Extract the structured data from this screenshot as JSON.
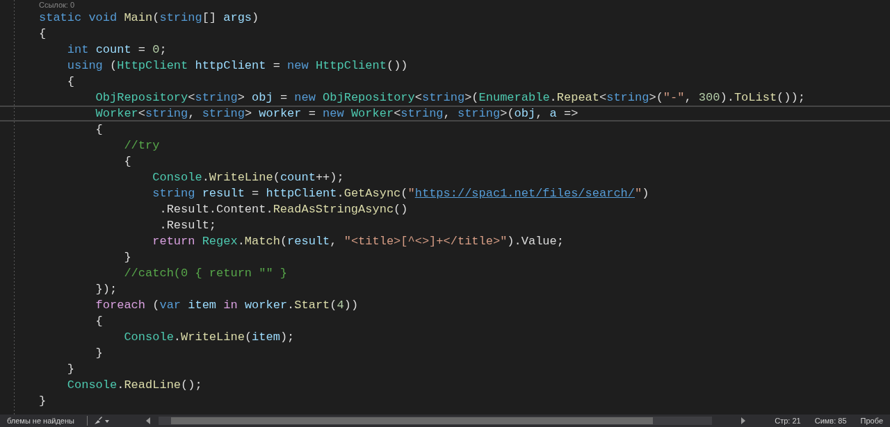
{
  "codelens": "Ссылок: 0",
  "code_lines": [
    {
      "current": false,
      "tokens": [
        {
          "text": "static void ",
          "kind": "kw"
        },
        {
          "text": "Main",
          "kind": "fn"
        },
        {
          "text": "(",
          "kind": "pl"
        },
        {
          "text": "string",
          "kind": "kw"
        },
        {
          "text": "[] ",
          "kind": "pl"
        },
        {
          "text": "args",
          "kind": "id"
        },
        {
          "text": ")",
          "kind": "pl"
        }
      ]
    },
    {
      "current": false,
      "tokens": [
        {
          "text": "{",
          "kind": "pl"
        }
      ]
    },
    {
      "current": false,
      "tokens": [
        {
          "text": "    int ",
          "kind": "kw"
        },
        {
          "text": "count",
          "kind": "id"
        },
        {
          "text": " = ",
          "kind": "pl"
        },
        {
          "text": "0",
          "kind": "num"
        },
        {
          "text": ";",
          "kind": "pl"
        }
      ]
    },
    {
      "current": false,
      "tokens": [
        {
          "text": "    using ",
          "kind": "kw"
        },
        {
          "text": "(",
          "kind": "pl"
        },
        {
          "text": "HttpClient ",
          "kind": "type"
        },
        {
          "text": "httpClient",
          "kind": "id"
        },
        {
          "text": " = ",
          "kind": "pl"
        },
        {
          "text": "new ",
          "kind": "kw"
        },
        {
          "text": "HttpClient",
          "kind": "type"
        },
        {
          "text": "())",
          "kind": "pl"
        }
      ]
    },
    {
      "current": false,
      "tokens": [
        {
          "text": "    {",
          "kind": "pl"
        }
      ]
    },
    {
      "current": false,
      "tokens": [
        {
          "text": "        ObjRepository",
          "kind": "type"
        },
        {
          "text": "<",
          "kind": "pl"
        },
        {
          "text": "string",
          "kind": "kw"
        },
        {
          "text": "> ",
          "kind": "pl"
        },
        {
          "text": "obj",
          "kind": "id"
        },
        {
          "text": " = ",
          "kind": "pl"
        },
        {
          "text": "new ",
          "kind": "kw"
        },
        {
          "text": "ObjRepository",
          "kind": "type"
        },
        {
          "text": "<",
          "kind": "pl"
        },
        {
          "text": "string",
          "kind": "kw"
        },
        {
          "text": ">(",
          "kind": "pl"
        },
        {
          "text": "Enumerable",
          "kind": "type"
        },
        {
          "text": ".",
          "kind": "pl"
        },
        {
          "text": "Repeat",
          "kind": "fn"
        },
        {
          "text": "<",
          "kind": "pl"
        },
        {
          "text": "string",
          "kind": "kw"
        },
        {
          "text": ">(",
          "kind": "pl"
        },
        {
          "text": "\"-\"",
          "kind": "str"
        },
        {
          "text": ", ",
          "kind": "pl"
        },
        {
          "text": "300",
          "kind": "num"
        },
        {
          "text": ").",
          "kind": "pl"
        },
        {
          "text": "ToList",
          "kind": "fn"
        },
        {
          "text": "());",
          "kind": "pl"
        }
      ]
    },
    {
      "current": true,
      "tokens": [
        {
          "text": "        Worker",
          "kind": "type"
        },
        {
          "text": "<",
          "kind": "pl"
        },
        {
          "text": "string",
          "kind": "kw"
        },
        {
          "text": ", ",
          "kind": "pl"
        },
        {
          "text": "string",
          "kind": "kw"
        },
        {
          "text": "> ",
          "kind": "pl"
        },
        {
          "text": "worker",
          "kind": "id"
        },
        {
          "text": " = ",
          "kind": "pl"
        },
        {
          "text": "new ",
          "kind": "kw"
        },
        {
          "text": "Worker",
          "kind": "type"
        },
        {
          "text": "<",
          "kind": "pl"
        },
        {
          "text": "string",
          "kind": "kw"
        },
        {
          "text": ", ",
          "kind": "pl"
        },
        {
          "text": "string",
          "kind": "kw"
        },
        {
          "text": ">(",
          "kind": "pl"
        },
        {
          "text": "obj",
          "kind": "id"
        },
        {
          "text": ", ",
          "kind": "pl"
        },
        {
          "text": "a",
          "kind": "id"
        },
        {
          "text": " =>",
          "kind": "pl"
        }
      ]
    },
    {
      "current": false,
      "tokens": [
        {
          "text": "        {",
          "kind": "pl"
        }
      ]
    },
    {
      "current": false,
      "tokens": [
        {
          "text": "            //try",
          "kind": "com"
        }
      ]
    },
    {
      "current": false,
      "tokens": [
        {
          "text": "            {",
          "kind": "pl"
        }
      ]
    },
    {
      "current": false,
      "tokens": [
        {
          "text": "                Console",
          "kind": "type"
        },
        {
          "text": ".",
          "kind": "pl"
        },
        {
          "text": "WriteLine",
          "kind": "fn"
        },
        {
          "text": "(",
          "kind": "pl"
        },
        {
          "text": "count",
          "kind": "id"
        },
        {
          "text": "++);",
          "kind": "pl"
        }
      ]
    },
    {
      "current": false,
      "tokens": [
        {
          "text": "                string ",
          "kind": "kw"
        },
        {
          "text": "result",
          "kind": "id"
        },
        {
          "text": " = ",
          "kind": "pl"
        },
        {
          "text": "httpClient",
          "kind": "id"
        },
        {
          "text": ".",
          "kind": "pl"
        },
        {
          "text": "GetAsync",
          "kind": "fn"
        },
        {
          "text": "(",
          "kind": "pl"
        },
        {
          "text": "\"",
          "kind": "str"
        },
        {
          "text": "https://spac1.net/files/search/",
          "kind": "url"
        },
        {
          "text": "\"",
          "kind": "str"
        },
        {
          "text": ")",
          "kind": "pl"
        }
      ]
    },
    {
      "current": false,
      "tokens": [
        {
          "text": "                 .Result.Content.",
          "kind": "pl"
        },
        {
          "text": "ReadAsStringAsync",
          "kind": "fn"
        },
        {
          "text": "()",
          "kind": "pl"
        }
      ]
    },
    {
      "current": false,
      "tokens": [
        {
          "text": "                 .Result;",
          "kind": "pl"
        }
      ]
    },
    {
      "current": false,
      "tokens": [
        {
          "text": "                return ",
          "kind": "ctl"
        },
        {
          "text": "Regex",
          "kind": "type"
        },
        {
          "text": ".",
          "kind": "pl"
        },
        {
          "text": "Match",
          "kind": "fn"
        },
        {
          "text": "(",
          "kind": "pl"
        },
        {
          "text": "result",
          "kind": "id"
        },
        {
          "text": ", ",
          "kind": "pl"
        },
        {
          "text": "\"<title>[^<>]+</title>\"",
          "kind": "str"
        },
        {
          "text": ").Value;",
          "kind": "pl"
        }
      ]
    },
    {
      "current": false,
      "tokens": [
        {
          "text": "            }",
          "kind": "pl"
        }
      ]
    },
    {
      "current": false,
      "tokens": [
        {
          "text": "            //catch(0 { return \"\" }",
          "kind": "com"
        }
      ]
    },
    {
      "current": false,
      "tokens": [
        {
          "text": "        });",
          "kind": "pl"
        }
      ]
    },
    {
      "current": false,
      "tokens": [
        {
          "text": "        foreach ",
          "kind": "ctl"
        },
        {
          "text": "(",
          "kind": "pl"
        },
        {
          "text": "var ",
          "kind": "kw"
        },
        {
          "text": "item ",
          "kind": "id"
        },
        {
          "text": "in ",
          "kind": "ctl"
        },
        {
          "text": "worker",
          "kind": "id"
        },
        {
          "text": ".",
          "kind": "pl"
        },
        {
          "text": "Start",
          "kind": "fn"
        },
        {
          "text": "(",
          "kind": "pl"
        },
        {
          "text": "4",
          "kind": "num"
        },
        {
          "text": "))",
          "kind": "pl"
        }
      ]
    },
    {
      "current": false,
      "tokens": [
        {
          "text": "        {",
          "kind": "pl"
        }
      ]
    },
    {
      "current": false,
      "tokens": [
        {
          "text": "            Console",
          "kind": "type"
        },
        {
          "text": ".",
          "kind": "pl"
        },
        {
          "text": "WriteLine",
          "kind": "fn"
        },
        {
          "text": "(",
          "kind": "pl"
        },
        {
          "text": "item",
          "kind": "id"
        },
        {
          "text": ");",
          "kind": "pl"
        }
      ]
    },
    {
      "current": false,
      "tokens": [
        {
          "text": "        }",
          "kind": "pl"
        }
      ]
    },
    {
      "current": false,
      "tokens": [
        {
          "text": "    }",
          "kind": "pl"
        }
      ]
    },
    {
      "current": false,
      "tokens": [
        {
          "text": "    Console",
          "kind": "type"
        },
        {
          "text": ".",
          "kind": "pl"
        },
        {
          "text": "ReadLine",
          "kind": "fn"
        },
        {
          "text": "();",
          "kind": "pl"
        }
      ]
    },
    {
      "current": false,
      "tokens": [
        {
          "text": "}",
          "kind": "pl"
        }
      ]
    }
  ],
  "status_bar": {
    "problems": "блемы не найдены",
    "line": "Стр: 21",
    "column": "Симв: 85",
    "spaces": "Пробе"
  }
}
